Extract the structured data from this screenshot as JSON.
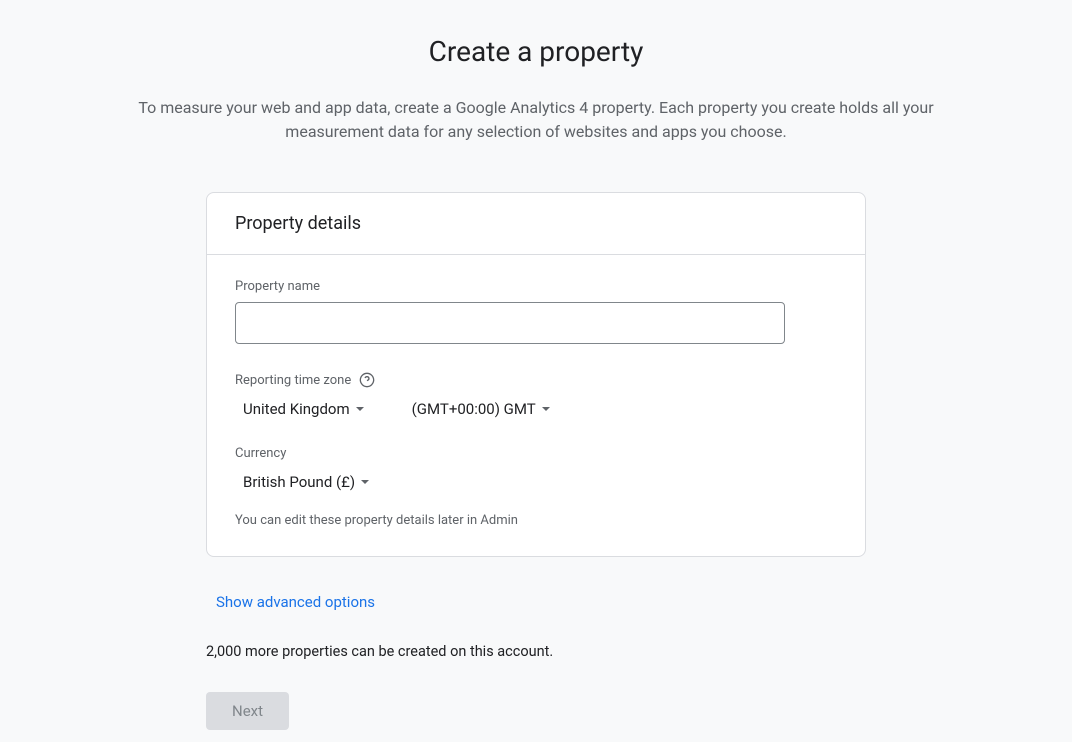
{
  "header": {
    "title": "Create a property",
    "description": "To measure your web and app data, create a Google Analytics 4 property. Each property you create holds all your measurement data for any selection of websites and apps you choose."
  },
  "card": {
    "title": "Property details",
    "property_name_label": "Property name",
    "property_name_value": "",
    "timezone_label": "Reporting time zone",
    "country_value": "United Kingdom",
    "timezone_value": "(GMT+00:00) GMT",
    "currency_label": "Currency",
    "currency_value": "British Pound (£)",
    "edit_note": "You can edit these property details later in Admin"
  },
  "advanced_link": "Show advanced options",
  "quota_text": "2,000 more properties can be created on this account.",
  "buttons": {
    "next": "Next"
  }
}
